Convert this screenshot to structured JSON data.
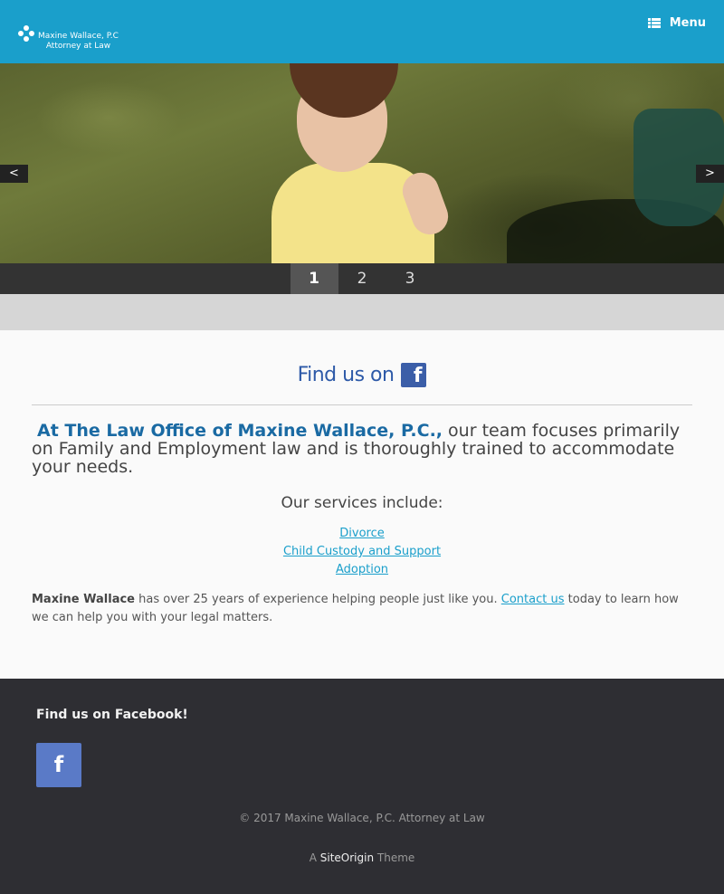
{
  "header": {
    "logo_line1": "Maxine Wallace, P.C",
    "logo_line2": "Attorney at Law",
    "menu_label": "Menu"
  },
  "slider": {
    "prev_label": "<",
    "next_label": ">",
    "pages": [
      "1",
      "2",
      "3"
    ],
    "active_page": "1"
  },
  "main": {
    "fb_find_text": "Find us on",
    "fb_glyph": "f",
    "intro_firm": "At The Law Office of Maxine Wallace, P.C.,",
    "intro_rest": " our team focuses primarily on Family and Employment law and is thoroughly trained to accommodate your needs.",
    "services_heading": "Our services include:",
    "services": [
      "Divorce",
      "Child Custody and Support",
      "Adoption"
    ],
    "experience_name": "Maxine Wallace",
    "experience_text": " has over 25 years of experience helping people just like you. ",
    "experience_link": "Contact us",
    "experience_tail": " today to learn how we can help you with your legal matters."
  },
  "footer": {
    "title": "Find us on Facebook!",
    "fb_glyph": "f",
    "copyright": "© 2017 Maxine Wallace, P.C. Attorney at Law",
    "credit_prefix": "A ",
    "credit_link": "SiteOrigin",
    "credit_suffix": " Theme"
  },
  "colors": {
    "header_bg": "#1a9fcb",
    "link": "#1a9fcb",
    "firm_name": "#1a6aa3",
    "footer_bg": "#2e2e33",
    "facebook": "#5a7ac7"
  }
}
